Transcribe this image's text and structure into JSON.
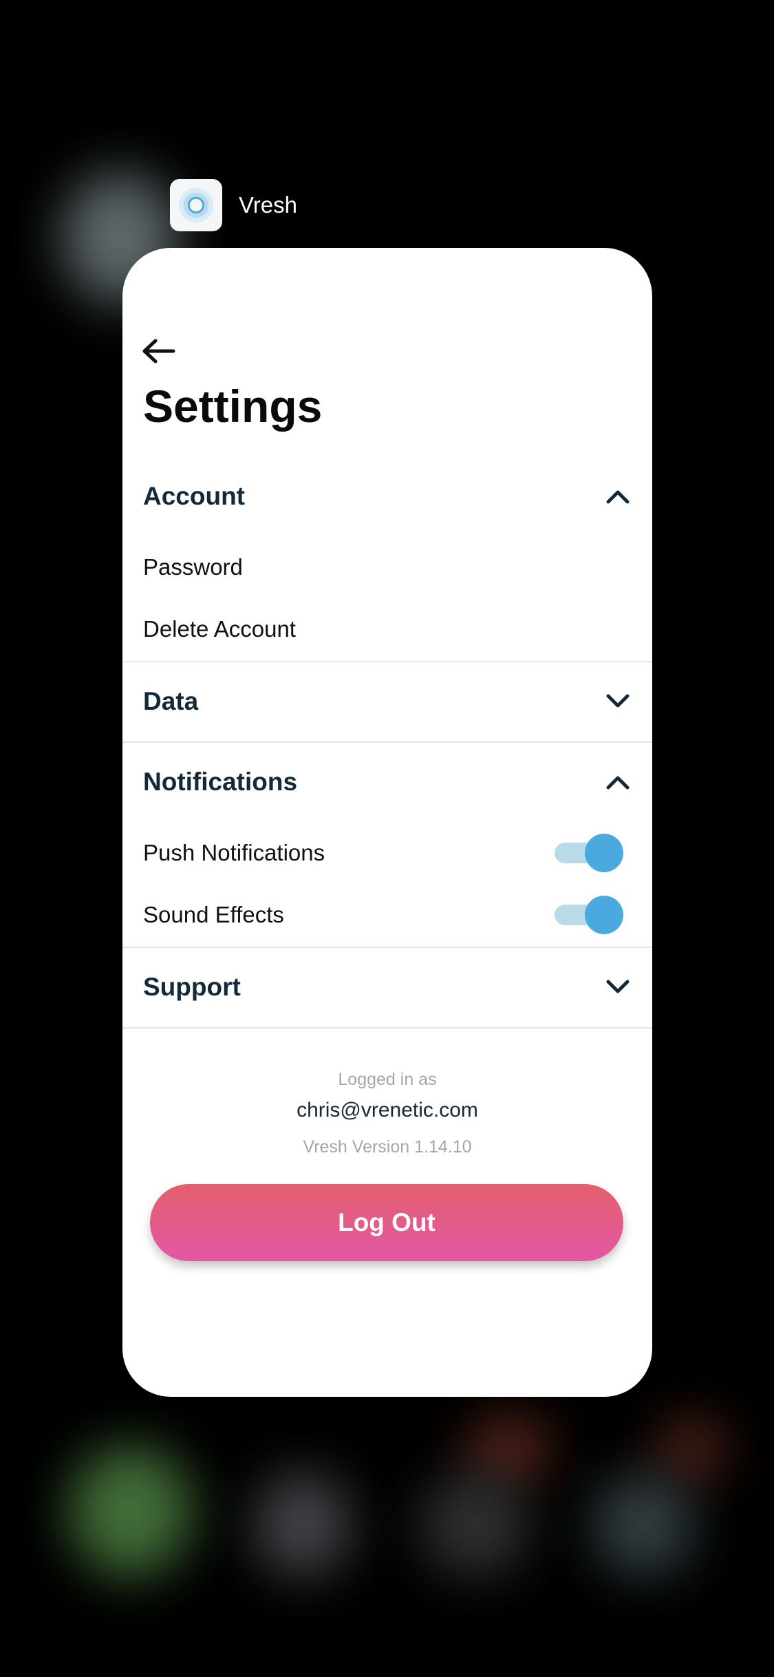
{
  "app_switcher": {
    "app_name": "Vresh",
    "app_icon": "vresh-ring-icon"
  },
  "settings": {
    "back_icon": "arrow-left-icon",
    "title": "Settings",
    "sections": [
      {
        "title": "Account",
        "expanded": true,
        "chevron": "chevron-up-icon",
        "items": [
          {
            "label": "Password"
          },
          {
            "label": "Delete Account"
          }
        ]
      },
      {
        "title": "Data",
        "expanded": false,
        "chevron": "chevron-down-icon"
      },
      {
        "title": "Notifications",
        "expanded": true,
        "chevron": "chevron-up-icon",
        "items": [
          {
            "label": "Push Notifications",
            "toggle_on": true
          },
          {
            "label": "Sound Effects",
            "toggle_on": true
          }
        ]
      },
      {
        "title": "Support",
        "expanded": false,
        "chevron": "chevron-down-icon"
      }
    ],
    "footer": {
      "logged_in_label": "Logged in as",
      "email": "chris@vrenetic.com",
      "version": "Vresh Version 1.14.10"
    },
    "logout_label": "Log Out"
  },
  "colors": {
    "accent_blue": "#4aa9de",
    "toggle_track": "#b9dbe8",
    "section_title": "#13293a",
    "logout_gradient_top": "#e45f6e",
    "logout_gradient_bottom": "#e258a4"
  }
}
